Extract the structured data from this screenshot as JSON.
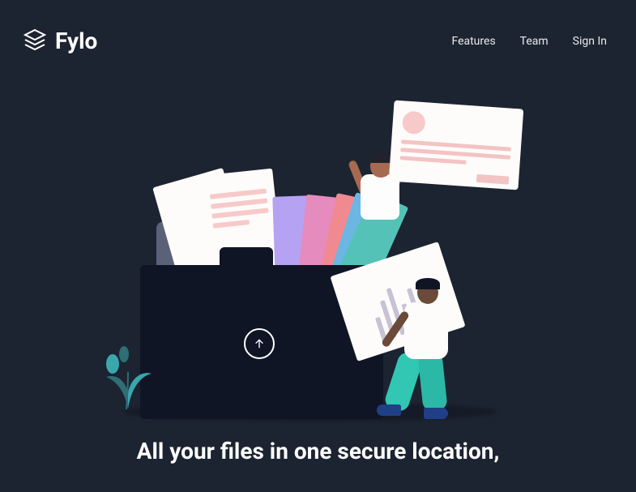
{
  "brand": {
    "name": "Fylo"
  },
  "nav": {
    "features": "Features",
    "team": "Team",
    "signin": "Sign In"
  },
  "hero": {
    "title": "All your files in one secure location,"
  },
  "icons": {
    "logo": "layers-icon",
    "upload": "upload-arrow-icon"
  }
}
